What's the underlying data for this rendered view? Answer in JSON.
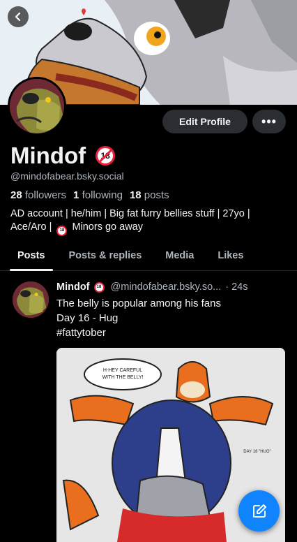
{
  "profile": {
    "display_name": "Mindof",
    "handle": "@mindofabear.bsky.social",
    "adult_badge": "18",
    "followers_count": "28",
    "followers_label": "followers",
    "following_count": "1",
    "following_label": "following",
    "posts_count": "18",
    "posts_label": "posts",
    "bio_line1": "AD account | he/him | Big fat furry bellies stuff | 27yo |",
    "bio_line2_before": "Ace/Aro |",
    "bio_line2_after": "Minors go away"
  },
  "actions": {
    "edit_profile": "Edit Profile",
    "more": "•••"
  },
  "tabs": [
    {
      "label": "Posts",
      "active": true
    },
    {
      "label": "Posts & replies",
      "active": false
    },
    {
      "label": "Media",
      "active": false
    },
    {
      "label": "Likes",
      "active": false
    }
  ],
  "post": {
    "author": "Mindof",
    "handle": "@mindofabear.bsky.so...",
    "time": "· 24s",
    "line1": "The belly is popular among his fans",
    "line2": "Day 16 - Hug",
    "line3": "#fattytober",
    "image_speech": "H-HEY CAREFUL WITH THE BELLY!",
    "image_caption": "DAY 16 \"HUG\""
  },
  "colors": {
    "background": "#000000",
    "button_bg": "#2a2e33",
    "muted_text": "#aeb5bd",
    "accent": "#1083fe",
    "badge_red": "#e8213a"
  }
}
